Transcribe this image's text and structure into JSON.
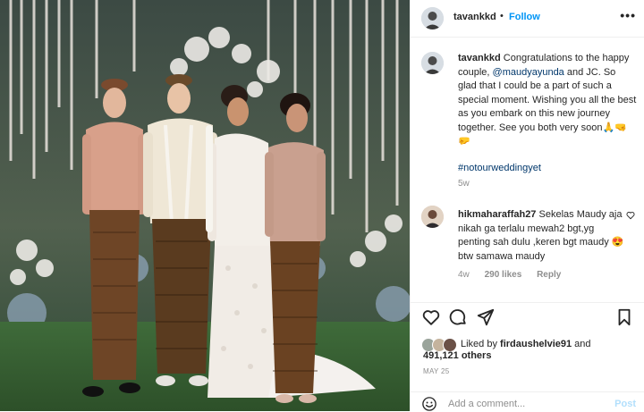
{
  "header": {
    "username": "tavankkd",
    "separator": "•",
    "follow_label": "Follow",
    "more_icon": "more-horizontal-icon"
  },
  "caption": {
    "username": "tavankkd",
    "text_before_mention": "Congratulations to the happy couple, ",
    "mention": "@maudyayunda",
    "text_after_mention": " and JC. So glad that I could be a part of such a special moment. Wishing you all the best as you embark on this new journey together. See you both very soon",
    "emojis": "🙏🤜🤛",
    "hashtag": "#notourweddingyet",
    "time": "5w"
  },
  "comment": {
    "username": "hikmaharaffah27",
    "text": "Sekelas Maudy aja nikah ga terlalu mewah2 bgt,yg penting sah dulu ,keren bgt maudy ",
    "emoji": "😍",
    "text_tail": "btw samawa maudy",
    "time": "4w",
    "likes": "290 likes",
    "reply_label": "Reply"
  },
  "actions": {
    "like_icon": "heart-icon",
    "comment_icon": "comment-icon",
    "share_icon": "send-icon",
    "save_icon": "bookmark-icon",
    "liked_by_prefix": "Liked by ",
    "liked_by_user": "firdaushelvie91",
    "liked_by_and": " and",
    "likes_count": "491,121 others",
    "date": "MAY 25"
  },
  "add_comment": {
    "placeholder": "Add a comment...",
    "post_label": "Post"
  },
  "colors": {
    "link_blue": "#0095f6",
    "mention_blue": "#00376b",
    "muted_gray": "#8e8e8e",
    "post_disabled": "#b2dffc"
  }
}
